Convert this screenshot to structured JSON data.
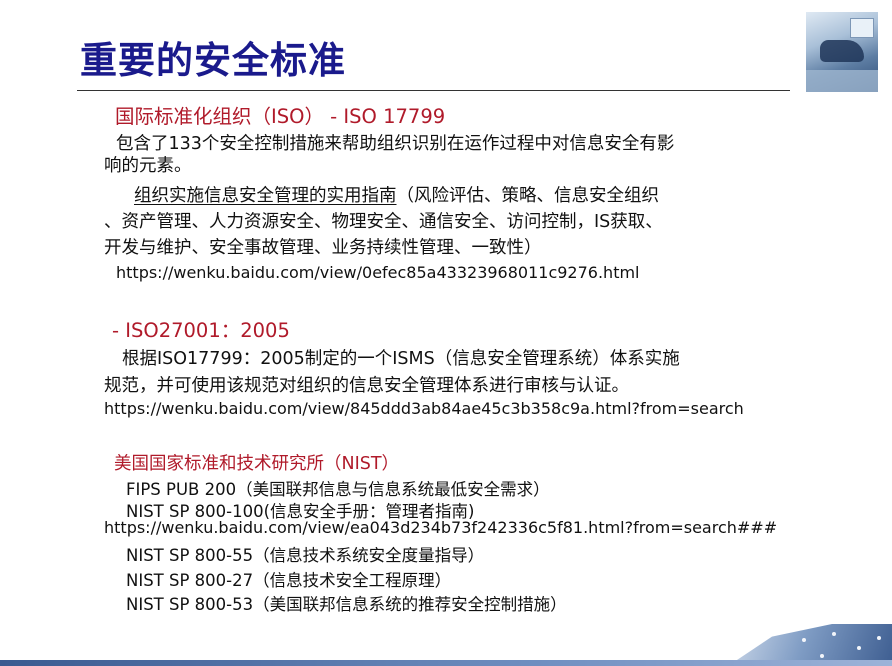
{
  "title": "重要的安全标准",
  "iso": {
    "heading": "国际标准化组织（ISO）",
    "heading_code": " - ISO 17799",
    "desc_1": "包含了133个安全控制措施来帮助组织识别在运作过程中对信息安全有影",
    "desc_2": "响的元素。",
    "guide_link": "组织实施信息安全管理的实用指南",
    "guide_1": "（风险评估、策略、信息安全组织",
    "guide_2": "、资产管理、人力资源安全、物理安全、通信安全、访问控制，IS获取、",
    "guide_3": "开发与维护、安全事故管理、业务持续性管理、一致性）",
    "url": "https://wenku.baidu.com/view/0efec85a43323968011c9276.html"
  },
  "iso27001": {
    "heading": "- ISO27001：2005",
    "desc_1": "根据ISO17799：2005制定的一个ISMS（信息安全管理系统）体系实施",
    "desc_2": "规范，并可使用该规范对组织的信息安全管理体系进行审核与认证。",
    "url": "https://wenku.baidu.com/view/845ddd3ab84ae45c3b358c9a.html?from=search"
  },
  "nist": {
    "heading": "美国国家标准和技术研究所（NIST）",
    "items": [
      {
        "code": "FIPS PUB 200",
        "desc": "（美国联邦信息与信息系统最低安全需求）"
      },
      {
        "code": "NIST SP 800-100",
        "desc": "(信息安全手册：管理者指南)"
      }
    ],
    "url": "https://wenku.baidu.com/view/ea043d234b73f242336c5f81.html?from=search###",
    "items_2": [
      {
        "code": "NIST SP 800-55",
        "desc": "（信息技术系统安全度量指导）"
      },
      {
        "code": "NIST SP 800-27",
        "desc": "（信息技术安全工程原理）"
      },
      {
        "code": "NIST SP 800-53",
        "desc": "（美国联邦信息系统的推荐安全控制措施）"
      }
    ]
  },
  "colors": {
    "title": "#1a1a8c",
    "heading": "#b01a2a"
  }
}
